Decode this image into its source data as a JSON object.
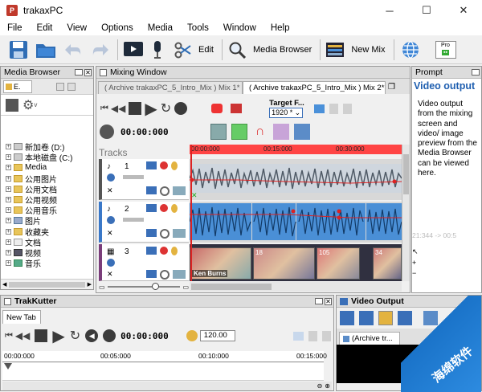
{
  "window": {
    "title": "trakaxPC",
    "minimize": "─",
    "maximize": "☐",
    "close": "✕"
  },
  "menu": [
    "File",
    "Edit",
    "View",
    "Options",
    "Media",
    "Tools",
    "Window",
    "Help"
  ],
  "toolbar": {
    "edit_label": "Edit",
    "media_browser_label": "Media Browser",
    "new_mix_label": "New Mix",
    "pro_label": "Pro"
  },
  "media_browser": {
    "title": "Media Browser",
    "tab_label": "E.",
    "items": [
      "新加卷 (D:)",
      "本地磁盘 (C:)",
      "Media",
      "公用图片",
      "公用文档",
      "公用视频",
      "公用音乐",
      "图片",
      "收藏夹",
      "文档",
      "视频",
      "音乐"
    ]
  },
  "mixing_window": {
    "title": "Mixing Window",
    "tabs": [
      "( Archive trakaxPC_5_Intro_Mix ) Mix 1*",
      "( Archive trakaxPC_5_Intro_Mix ) Mix 2*"
    ],
    "target_label": "Target F...",
    "target_value": "1920 *",
    "time": "00:00:000",
    "tracks_label": "Tracks",
    "ruler": [
      "00:00:000",
      "00:15:000",
      "00:30:000"
    ],
    "track_numbers": [
      "1",
      "2",
      "3"
    ],
    "ken_burns": "Ken Burns",
    "clip_numbers": [
      "18",
      "105",
      "34"
    ],
    "ghost_time": "21:344 -> 00:5"
  },
  "prompt": {
    "title": "Prompt",
    "heading": "Video output",
    "body": "Video output from the mixing screen and video/ image preview from the Media Browser can be viewed here."
  },
  "trakkutter": {
    "title": "TrakKutter",
    "tab": "New Tab",
    "time": "00:00:000",
    "tempo": "120.00",
    "ruler": [
      "00:00:000",
      "00:05:000",
      "00:10:000",
      "00:15:000"
    ]
  },
  "video_output": {
    "title": "Video Output",
    "tab": "(Archive tr..."
  },
  "watermark": "海绵软件"
}
